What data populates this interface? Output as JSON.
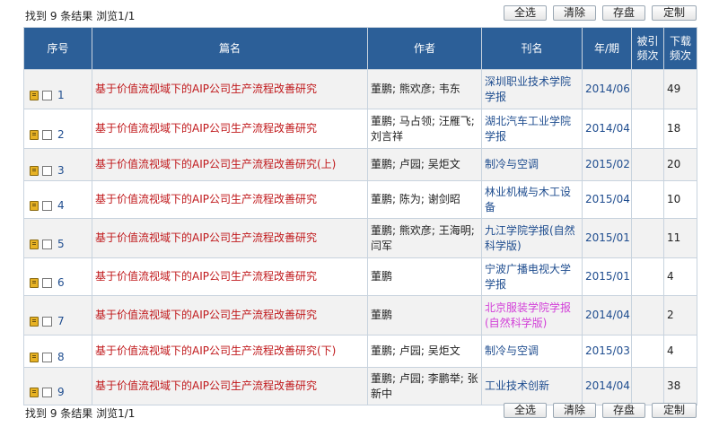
{
  "summary": {
    "result_text": "找到 9 条结果  浏览1/1"
  },
  "buttons": {
    "select_all": "全选",
    "clear": "清除",
    "save": "存盘",
    "custom": "定制"
  },
  "columns": {
    "index": "序号",
    "title": "篇名",
    "author": "作者",
    "journal": "刊名",
    "year": "年/期",
    "cited": "被引\n频次",
    "downloads": "下载\n频次"
  },
  "rows": [
    {
      "num": "1",
      "title": "基于价值流视域下的AIP公司生产流程改善研究",
      "authors": "董鹏; 熊欢彦; 韦东",
      "journal": "深圳职业技术学院学报",
      "year": "2014/06",
      "cited": "",
      "downloads": "49"
    },
    {
      "num": "2",
      "title": "基于价值流视域下的AIP公司生产流程改善研究",
      "authors": "董鹏; 马占领; 汪雁飞; 刘言祥",
      "journal": "湖北汽车工业学院学报",
      "year": "2014/04",
      "cited": "",
      "downloads": "18"
    },
    {
      "num": "3",
      "title": "基于价值流视域下的AIP公司生产流程改善研究(上)",
      "authors": "董鹏; 卢园; 吴炬文",
      "journal": "制冷与空调",
      "year": "2015/02",
      "cited": "",
      "downloads": "20"
    },
    {
      "num": "4",
      "title": "基于价值流视域下的AIP公司生产流程改善研究",
      "authors": "董鹏; 陈为; 谢剑昭",
      "journal": "林业机械与木工设备",
      "year": "2015/04",
      "cited": "",
      "downloads": "10"
    },
    {
      "num": "5",
      "title": "基于价值流视域下的AIP公司生产流程改善研究",
      "authors": "董鹏; 熊欢彦; 王海明; 闫军",
      "journal": "九江学院学报(自然科学版)",
      "year": "2015/01",
      "cited": "",
      "downloads": "11"
    },
    {
      "num": "6",
      "title": "基于价值流视域下的AIP公司生产流程改善研究",
      "authors": "董鹏",
      "journal": "宁波广播电视大学学报",
      "year": "2015/01",
      "cited": "",
      "downloads": "4"
    },
    {
      "num": "7",
      "title": "基于价值流视域下的AIP公司生产流程改善研究",
      "authors": "董鹏",
      "journal": "北京服装学院学报(自然科学版)",
      "year": "2014/04",
      "cited": "",
      "downloads": "2",
      "journal_color": "#d23fd8"
    },
    {
      "num": "8",
      "title": "基于价值流视域下的AIP公司生产流程改善研究(下)",
      "authors": "董鹏; 卢园; 吴炬文",
      "journal": "制冷与空调",
      "year": "2015/03",
      "cited": "",
      "downloads": "4"
    },
    {
      "num": "9",
      "title": "基于价值流视域下的AIP公司生产流程改善研究",
      "authors": "董鹏; 卢园; 李鹏举; 张新中",
      "journal": "工业技术创新",
      "year": "2014/04",
      "cited": "",
      "downloads": "38"
    }
  ],
  "colors": {
    "header_bg": "#2c5f98",
    "title_link": "#c0181b",
    "link_blue": "#1f4d8f",
    "journal_highlight": "#d23fd8"
  },
  "icons": {
    "row_icon": "document-icon",
    "row_checkbox": "checkbox-icon"
  }
}
